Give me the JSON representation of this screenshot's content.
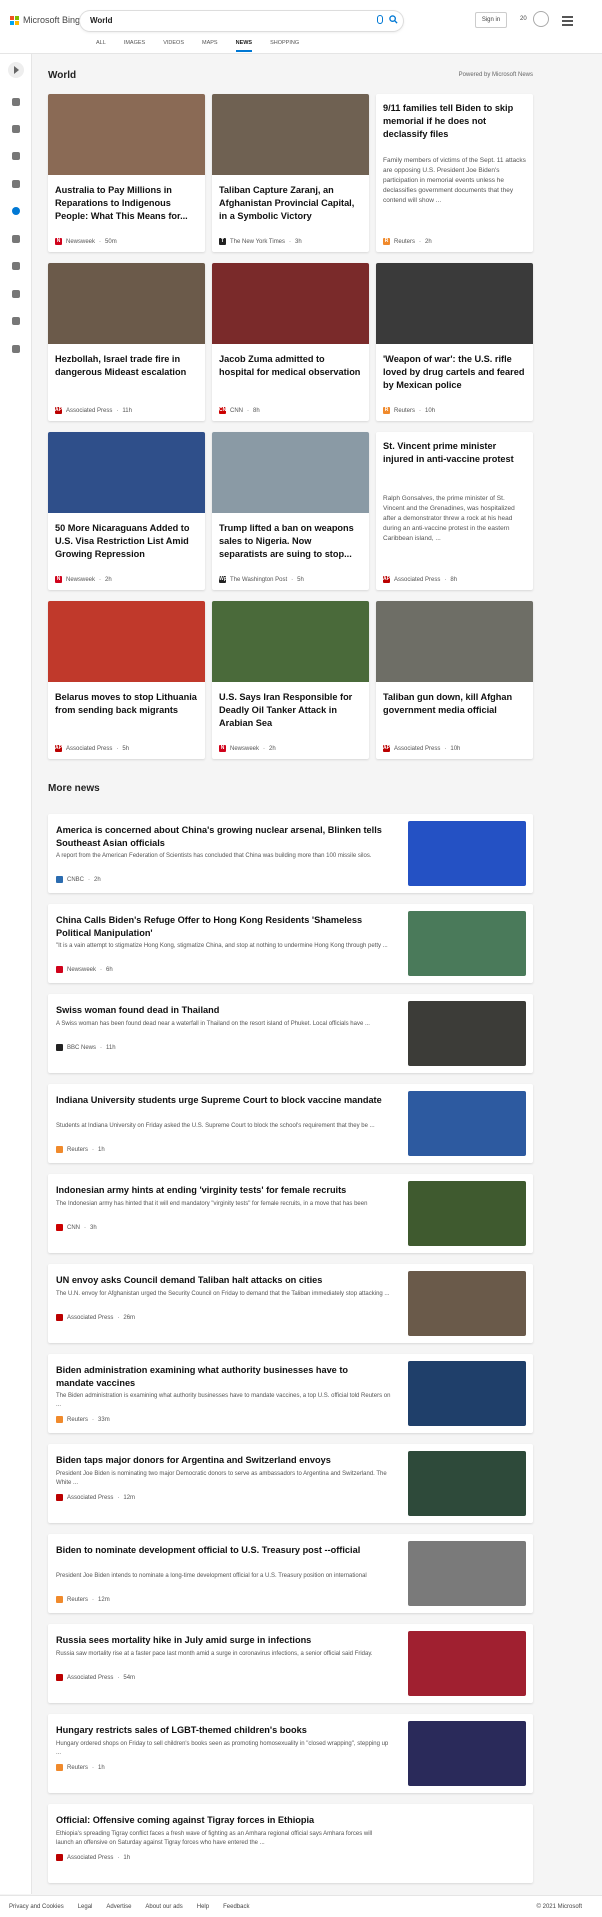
{
  "header": {
    "brand": "Microsoft Bing",
    "query": "World",
    "signin": "Sign in",
    "points": "20",
    "tabs": [
      "ALL",
      "IMAGES",
      "VIDEOS",
      "MAPS",
      "NEWS",
      "SHOPPING"
    ]
  },
  "section": {
    "title": "World",
    "powered": "Powered by Microsoft News"
  },
  "cards": [
    {
      "title": "Australia to Pay Millions in Reparations to Indigenous People: What This Means for...",
      "source": "Newsweek",
      "time": "50m",
      "logo": "N",
      "logo_color": "#d0021b",
      "img": "#8a6a55"
    },
    {
      "title": "Taliban Capture Zaranj, an Afghanistan Provincial Capital, in a Symbolic Victory",
      "source": "The New York Times",
      "time": "3h",
      "logo": "T",
      "logo_color": "#222",
      "img": "#6f6152"
    },
    {
      "title": "9/11 families tell Biden to skip memorial if he does not declassify files",
      "snippet": "Family members of victims of the Sept. 11 attacks are opposing U.S. President Joe Biden's participation in memorial events unless he declassifies government documents that they contend will show ...",
      "source": "Reuters",
      "time": "2h",
      "logo": "R",
      "logo_color": "#f08a2c",
      "img": ""
    },
    {
      "title": "Hezbollah, Israel trade fire in dangerous Mideast escalation",
      "source": "Associated Press",
      "time": "11h",
      "logo": "AP",
      "logo_color": "#b00",
      "img": "#6b5a4a"
    },
    {
      "title": "Jacob Zuma admitted to hospital for medical observation",
      "source": "CNN",
      "time": "8h",
      "logo": "CNN",
      "logo_color": "#cc0000",
      "img": "#7a2a2a"
    },
    {
      "title": "'Weapon of war': the U.S. rifle loved by drug cartels and feared by Mexican police",
      "source": "Reuters",
      "time": "10h",
      "logo": "R",
      "logo_color": "#f08a2c",
      "img": "#3a3a3a"
    },
    {
      "title": "50 More Nicaraguans Added to U.S. Visa Restriction List Amid Growing Repression",
      "source": "Newsweek",
      "time": "2h",
      "logo": "N",
      "logo_color": "#d0021b",
      "img": "#2f4f8a"
    },
    {
      "title": "Trump lifted a ban on weapons sales to Nigeria. Now separatists are suing to stop...",
      "source": "The Washington Post",
      "time": "5h",
      "logo": "Wp",
      "logo_color": "#222",
      "img": "#8a9aa5"
    },
    {
      "title": "St. Vincent prime minister injured in anti-vaccine protest",
      "snippet": "Ralph Gonsalves, the prime minister of St. Vincent and the Grenadines, was hospitalized after a demonstrator threw a rock at his head during an anti-vaccine protest in the eastern Caribbean island, ...",
      "source": "Associated Press",
      "time": "8h",
      "logo": "AP",
      "logo_color": "#b00",
      "img": ""
    },
    {
      "title": "Belarus moves to stop Lithuania from sending back migrants",
      "source": "Associated Press",
      "time": "5h",
      "logo": "AP",
      "logo_color": "#b00",
      "img": "#c0392b"
    },
    {
      "title": "U.S. Says Iran Responsible for Deadly Oil Tanker Attack in Arabian Sea",
      "source": "Newsweek",
      "time": "2h",
      "logo": "N",
      "logo_color": "#d0021b",
      "img": "#4a6a3a"
    },
    {
      "title": "Taliban gun down, kill Afghan government media official",
      "source": "Associated Press",
      "time": "10h",
      "logo": "AP",
      "logo_color": "#b00",
      "img": "#6e6e66"
    }
  ],
  "more_news": {
    "title": "More news",
    "items": [
      {
        "title": "America is concerned about China's growing nuclear arsenal, Blinken tells Southeast Asian officials",
        "snippet": "A report from the American Federation of Scientists has concluded that China was building more than 100 missile silos.",
        "source": "CNBC",
        "time": "2h",
        "logo": "C",
        "logo_color": "#2b6cb0",
        "img": "#2451c4"
      },
      {
        "title": "China Calls Biden's Refuge Offer to Hong Kong Residents 'Shameless Political Manipulation'",
        "snippet": "\"It is a vain attempt to stigmatize Hong Kong, stigmatize China, and stop at nothing to undermine Hong Kong through petty ...",
        "source": "Newsweek",
        "time": "6h",
        "logo": "N",
        "logo_color": "#d0021b",
        "img": "#4a7a5a"
      },
      {
        "title": "Swiss woman found dead in Thailand",
        "snippet": "A Swiss woman has been found dead near a waterfall in Thailand on the resort island of Phuket. Local officials have ...",
        "source": "BBC News",
        "time": "11h",
        "logo": "B",
        "logo_color": "#222",
        "img": "#3c3c38"
      },
      {
        "title": "Indiana University students urge Supreme Court to block vaccine mandate",
        "snippet": "Students at Indiana University on Friday asked the U.S. Supreme Court to block the school's requirement that they be ...",
        "source": "Reuters",
        "time": "1h",
        "logo": "R",
        "logo_color": "#f08a2c",
        "img": "#2d5aa0"
      },
      {
        "title": "Indonesian army hints at ending 'virginity tests' for female recruits",
        "snippet": "The Indonesian army has hinted that it will end mandatory \"virginity tests\" for female recruits, in a move that has been",
        "source": "CNN",
        "time": "3h",
        "logo": "CNN",
        "logo_color": "#cc0000",
        "img": "#3f5a2f"
      },
      {
        "title": "UN envoy asks Council demand Taliban halt attacks on cities",
        "snippet": "The U.N. envoy for Afghanistan urged the Security Council on Friday to demand that the Taliban immediately stop attacking ...",
        "source": "Associated Press",
        "time": "26m",
        "logo": "AP",
        "logo_color": "#b00",
        "img": "#6a5a4a"
      },
      {
        "title": "Biden administration examining what authority businesses have to mandate vaccines",
        "snippet": "The Biden administration is examining what authority businesses have to mandate vaccines, a top U.S. official told Reuters on ...",
        "source": "Reuters",
        "time": "33m",
        "logo": "R",
        "logo_color": "#f08a2c",
        "img": "#1f3f6a"
      },
      {
        "title": "Biden taps major donors for Argentina and Switzerland envoys",
        "snippet": "President Joe Biden is nominating two major Democratic donors to serve as ambassadors to Argentina and Switzerland. The White ...",
        "source": "Associated Press",
        "time": "12m",
        "logo": "AP",
        "logo_color": "#b00",
        "img": "#2e4a3a"
      },
      {
        "title": "Biden to nominate development official to U.S. Treasury post --official",
        "snippet": "President Joe Biden intends to nominate a long-time development official for a U.S. Treasury position on international",
        "source": "Reuters",
        "time": "12m",
        "logo": "R",
        "logo_color": "#f08a2c",
        "img": "#7a7a7a"
      },
      {
        "title": "Russia sees mortality hike in July amid surge in infections",
        "snippet": "Russia saw mortality rise at a faster pace last month amid a surge in coronavirus infections, a senior official said Friday.",
        "source": "Associated Press",
        "time": "54m",
        "logo": "AP",
        "logo_color": "#b00",
        "img": "#a02030"
      },
      {
        "title": "Hungary restricts sales of LGBT-themed children's books",
        "snippet": "Hungary ordered shops on Friday to sell children's books seen as promoting homosexuality in \"closed wrapping\", stepping up ...",
        "source": "Reuters",
        "time": "1h",
        "logo": "R",
        "logo_color": "#f08a2c",
        "img": "#2a2a5a"
      },
      {
        "title": "Official: Offensive coming against Tigray forces in Ethiopia",
        "snippet": "Ethiopia's spreading Tigray conflict faces a fresh wave of fighting as an Amhara regional official says Amhara forces will launch an offensive on Saturday against Tigray forces who have entered the ...",
        "source": "Associated Press",
        "time": "1h",
        "logo": "AP",
        "logo_color": "#b00",
        "img": ""
      }
    ]
  },
  "footer": {
    "links": [
      "Privacy and Cookies",
      "Legal",
      "Advertise",
      "About our ads",
      "Help",
      "Feedback"
    ],
    "copyright": "© 2021 Microsoft"
  }
}
